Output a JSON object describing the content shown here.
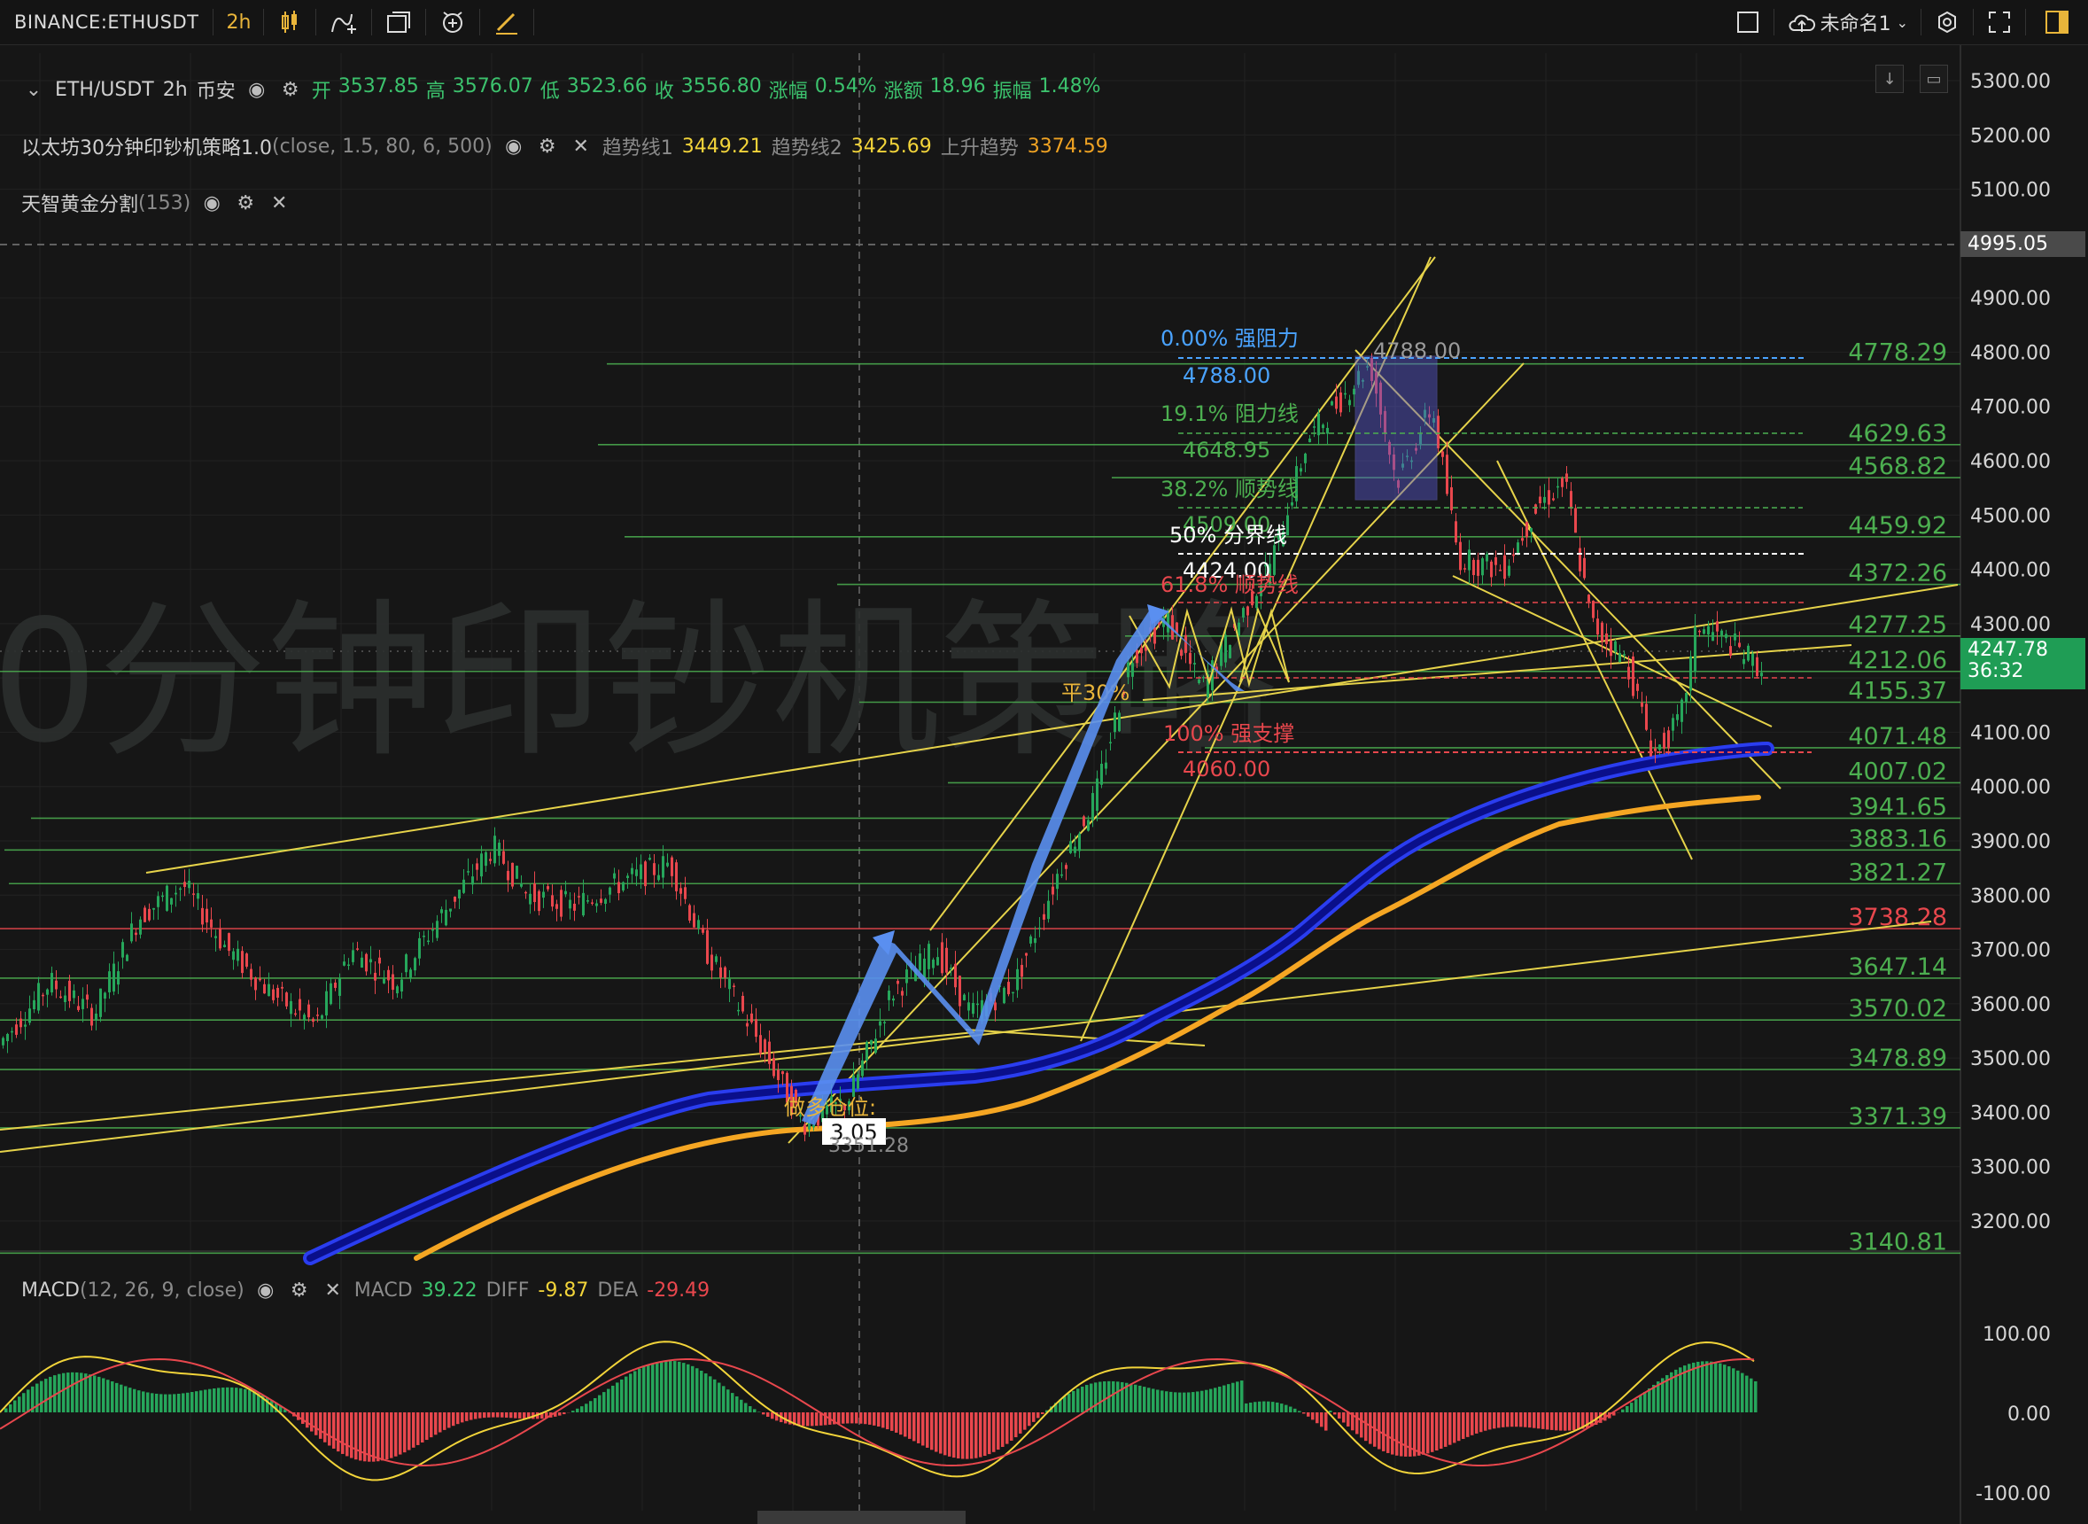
{
  "toolbar": {
    "symbol": "BINANCE:ETHUSDT",
    "interval": "2h",
    "layout_name": "未命名1",
    "icons": [
      "candles-icon",
      "indicators-icon",
      "layout-icon",
      "alert-icon",
      "drawing-icon",
      "square-icon",
      "cloud-save-icon",
      "gear-icon",
      "fullscreen-icon",
      "panel-icon"
    ]
  },
  "legend": {
    "main": {
      "title": "ETH/USDT",
      "interval": "2h",
      "exchange": "币安",
      "open_label": "开",
      "open": "3537.85",
      "high_label": "高",
      "high": "3576.07",
      "low_label": "低",
      "low": "3523.66",
      "close_label": "收",
      "close": "3556.80",
      "chg_pct_label": "涨幅",
      "chg_pct": "0.54%",
      "chg_label": "涨额",
      "chg": "18.96",
      "amp_label": "振幅",
      "amp": "1.48%"
    },
    "strategy": {
      "name": "以太坊30分钟印钞机策略1.0",
      "params": "(close, 1.5, 80, 6, 500)",
      "trend1_label": "趋势线1",
      "trend1": "3449.21",
      "trend2_label": "趋势线2",
      "trend2": "3425.69",
      "up_label": "上升趋势",
      "up": "3374.59"
    },
    "golden": {
      "name": "天智黄金分割",
      "params": "(153)"
    },
    "macd": {
      "name": "MACD",
      "params": "(12, 26, 9, close)",
      "macd_label": "MACD",
      "macd": "39.22",
      "diff_label": "DIFF",
      "diff": "-9.87",
      "dea_label": "DEA",
      "dea": "-29.49"
    }
  },
  "watermark": "0分钟印钞机策略",
  "price_axis": [
    "5300.00",
    "5200.00",
    "5100.00",
    "4900.00",
    "4800.00",
    "4700.00",
    "4600.00",
    "4500.00",
    "4400.00",
    "4300.00",
    "4200.00",
    "4100.00",
    "4000.00",
    "3900.00",
    "3800.00",
    "3700.00",
    "3600.00",
    "3500.00",
    "3400.00",
    "3300.00",
    "3200.00"
  ],
  "price_axis_values": [
    5300,
    5200,
    5100,
    4900,
    4800,
    4700,
    4600,
    4500,
    4400,
    4300,
    4200,
    4100,
    4000,
    3900,
    3800,
    3700,
    3600,
    3500,
    3400,
    3300,
    3200
  ],
  "crosshair_price": "4995.05",
  "current_price": "4247.78",
  "countdown": "36:32",
  "macd_axis": [
    "100.00",
    "0.00",
    "-100.00"
  ],
  "levels": [
    {
      "value": 4778.29,
      "label": "4778.29",
      "color": "#4caf50"
    },
    {
      "value": 4629.63,
      "label": "4629.63",
      "color": "#4caf50"
    },
    {
      "value": 4568.82,
      "label": "4568.82",
      "color": "#4caf50"
    },
    {
      "value": 4459.92,
      "label": "4459.92",
      "color": "#4caf50"
    },
    {
      "value": 4372.26,
      "label": "4372.26",
      "color": "#4caf50"
    },
    {
      "value": 4277.25,
      "label": "4277.25",
      "color": "#4caf50"
    },
    {
      "value": 4212.06,
      "label": "4212.06",
      "color": "#4caf50"
    },
    {
      "value": 4155.37,
      "label": "4155.37",
      "color": "#4caf50"
    },
    {
      "value": 4071.48,
      "label": "4071.48",
      "color": "#4caf50"
    },
    {
      "value": 4007.02,
      "label": "4007.02",
      "color": "#4caf50"
    },
    {
      "value": 3941.65,
      "label": "3941.65",
      "color": "#4caf50"
    },
    {
      "value": 3883.16,
      "label": "3883.16",
      "color": "#4caf50"
    },
    {
      "value": 3821.27,
      "label": "3821.27",
      "color": "#4caf50"
    },
    {
      "value": 3738.28,
      "label": "3738.28",
      "color": "#e8474d"
    },
    {
      "value": 3647.14,
      "label": "3647.14",
      "color": "#4caf50"
    },
    {
      "value": 3570.02,
      "label": "3570.02",
      "color": "#4caf50"
    },
    {
      "value": 3478.89,
      "label": "3478.89",
      "color": "#4caf50"
    },
    {
      "value": 3371.39,
      "label": "3371.39",
      "color": "#4caf50"
    },
    {
      "value": 3140.81,
      "label": "3140.81",
      "color": "#4caf50"
    }
  ],
  "fib": {
    "l0": "0.00% 强阻力",
    "v0": "4788.00",
    "l191": "19.1% 阻力线",
    "v191": "4648.95",
    "l382": "38.2% 顺势线",
    "v382": "4509.00",
    "l50": "50% 分界线",
    "v50": "4424.00",
    "l618": "61.8% 顺势线",
    "l100": "100% 强支撑",
    "v100": "4060.00",
    "peak": "4788.00",
    "flat30": "平30%"
  },
  "annotations": {
    "long_entry": "做多仓位:",
    "position_box": "3.05",
    "low_label": "3351.28"
  },
  "colors": {
    "up": "#26a65b",
    "down": "#e8474d",
    "accent": "#e9b53a",
    "blue_band": "#1e2bd8",
    "orange_line": "#f5a623",
    "fib_blue": "#4aa3ff"
  }
}
